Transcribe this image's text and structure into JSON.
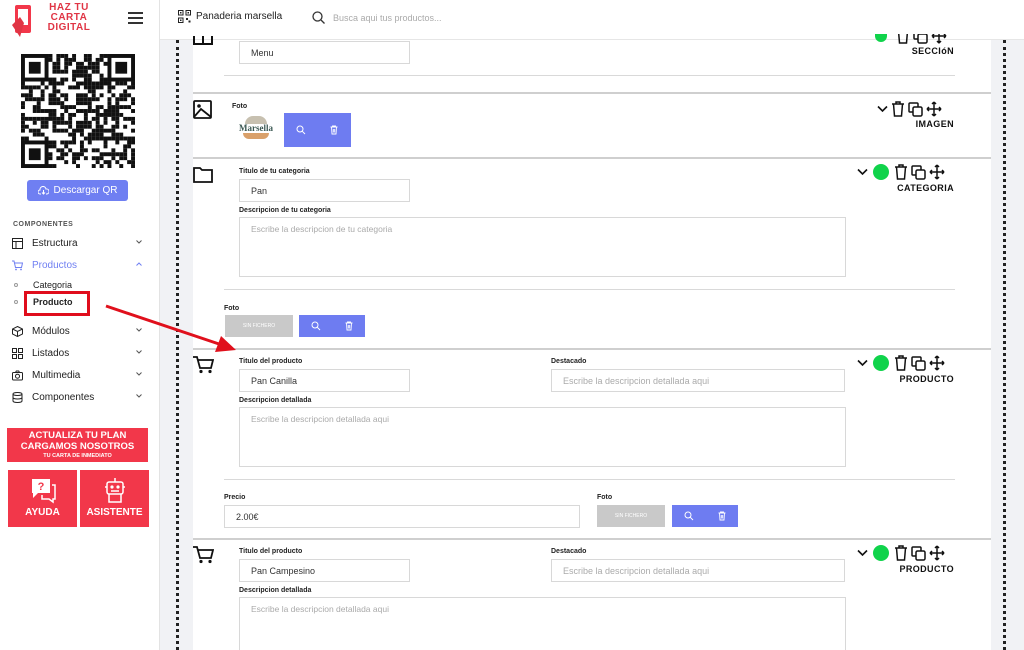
{
  "brand": {
    "logo_line1": "HAZ TU",
    "logo_line2": "CARTA",
    "logo_line3": "DIGITAL"
  },
  "sidebar": {
    "download_qr": "Descargar QR",
    "section_title": "COMPONENTES",
    "items": [
      {
        "label": "Estructura",
        "icon": "layout-icon"
      },
      {
        "label": "Productos",
        "icon": "cart-icon"
      },
      {
        "label": "Módulos",
        "icon": "cube-icon"
      },
      {
        "label": "Listados",
        "icon": "grid-icon"
      },
      {
        "label": "Multimedia",
        "icon": "camera-icon"
      },
      {
        "label": "Componentes",
        "icon": "database-icon"
      }
    ],
    "sub_items": [
      "Categoria",
      "Producto"
    ],
    "promo": {
      "line1": "ACTUALIZA TU PLAN",
      "line2": "CARGAMOS NOSOTROS",
      "line3": "TU CARTA DE INMEDIATO"
    },
    "help_label": "AYUDA",
    "assistant_label": "ASISTENTE"
  },
  "topbar": {
    "store": "Panaderia marsella",
    "search_placeholder": "Busca aqui tus productos..."
  },
  "blocks": {
    "section": {
      "value": "Menu",
      "type": "SECCIóN"
    },
    "image": {
      "label": "Foto",
      "type": "IMAGEN",
      "thumb_text": "Marsella"
    },
    "category": {
      "title_label": "Titulo de tu categoria",
      "title_value": "Pan",
      "desc_label": "Descripcion de tu categoria",
      "desc_placeholder": "Escribe la descripcion de tu categoria",
      "photo_label": "Foto",
      "nofile": "SIN FICHERO",
      "type": "CATEGORIA"
    },
    "product1": {
      "title_label": "Titulo del producto",
      "title_value": "Pan Canilla",
      "featured_label": "Destacado",
      "featured_placeholder": "Escribe la descripcion detallada aqui",
      "desc_label": "Descripcion detallada",
      "desc_placeholder": "Escribe la descripcion detallada aqui",
      "price_label": "Precio",
      "price_value": "2.00€",
      "photo_label": "Foto",
      "nofile": "SIN FICHERO",
      "type": "PRODUCTO"
    },
    "product2": {
      "title_label": "Titulo del producto",
      "title_value": "Pan Campesino",
      "featured_label": "Destacado",
      "featured_placeholder": "Escribe la descripcion detallada aqui",
      "desc_label": "Descripcion detallada",
      "desc_placeholder": "Escribe la descripcion detallada aqui",
      "type": "PRODUCTO"
    }
  },
  "colors": {
    "accent": "#6f7ff2",
    "brand_red": "#f2374a",
    "active_green": "#10d34b",
    "highlight": "#e00d1c"
  }
}
